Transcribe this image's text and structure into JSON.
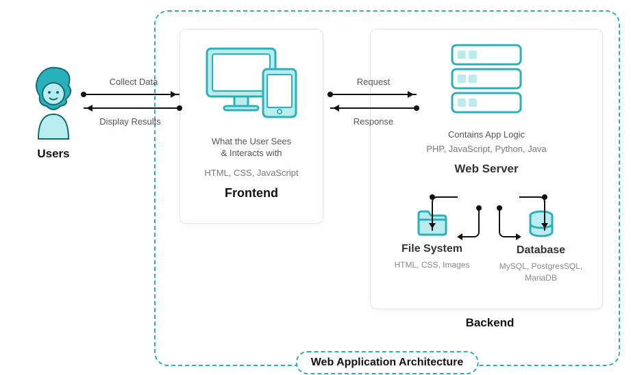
{
  "title": "Web Application Architecture",
  "users": {
    "label": "Users"
  },
  "flow1": {
    "top": "Collect Data",
    "bottom": "Display Results"
  },
  "flow2": {
    "top": "Request",
    "bottom": "Response"
  },
  "frontend": {
    "desc1": "What the User Sees",
    "desc2": "& Interacts with",
    "tech": "HTML, CSS, JavaScript",
    "title": "Frontend"
  },
  "webserver": {
    "desc": "Contains App Logic",
    "tech": "PHP, JavaScript, Python, Java",
    "title": "Web Server"
  },
  "filesystem": {
    "title": "File System",
    "tech": "HTML, CSS, Images"
  },
  "database": {
    "title": "Database",
    "tech": "MySQL, PostgresSQL, MariaDB"
  },
  "backendLabel": "Backend"
}
